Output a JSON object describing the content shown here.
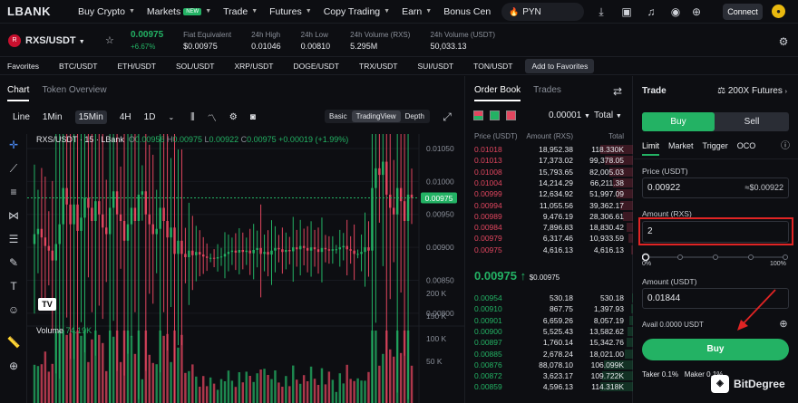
{
  "nav": {
    "logo": "LBANK",
    "items": [
      "Buy Crypto",
      "Markets",
      "Trade",
      "Futures",
      "Copy Trading",
      "Earn",
      "Bonus Cen"
    ],
    "markets_badge": "NEW",
    "search": "PYN",
    "connect": "Connect",
    "icons": [
      "download-icon",
      "wallet-icon",
      "bell-icon",
      "globe-icon",
      "gift-icon"
    ]
  },
  "ticker": {
    "pair": "RXS/USDT",
    "price": "0.00975",
    "change": "+6.67%",
    "fiat_label": "Fiat Equivalent",
    "fiat_value": "$0.00975",
    "high_label": "24h High",
    "high": "0.01046",
    "low_label": "24h Low",
    "low": "0.00810",
    "vol_rxs_label": "24h Volume (RXS)",
    "vol_rxs": "5.295M",
    "vol_usdt_label": "24h Volume (USDT)",
    "vol_usdt": "50,033.13"
  },
  "favorites": {
    "label": "Favorites",
    "items": [
      "BTC/USDT",
      "ETH/USDT",
      "SOL/USDT",
      "XRP/USDT",
      "DOGE/USDT",
      "TRX/USDT",
      "SUI/USDT",
      "TON/USDT"
    ],
    "add": "Add to Favorites"
  },
  "chart": {
    "tabs": [
      "Chart",
      "Token Overview"
    ],
    "timeframes": [
      "Line",
      "1Min",
      "15Min",
      "4H",
      "1D"
    ],
    "selected_tf": "15Min",
    "modes": [
      "Basic",
      "TradingView",
      "Depth"
    ],
    "selected_mode": "TradingView",
    "title": "RXS/USDT · 15 · LBank",
    "o": "0.00956",
    "h": "0.00975",
    "l": "0.00922",
    "c": "0.00975",
    "chg": "+0.00019 (+1.99%)",
    "volume_label": "Volume",
    "volume_value": "74.19K",
    "price_ticks": [
      "0.01050",
      "0.01000",
      "0.00950",
      "0.00900",
      "0.00850",
      "0.00800"
    ],
    "current_price_tag": "0.00975",
    "vol_ticks": [
      "200 K",
      "150 K",
      "100 K",
      "50 K"
    ],
    "tv_logo": "TV"
  },
  "orderbook": {
    "tabs": [
      "Order Book",
      "Trades"
    ],
    "tick": "0.00001",
    "total_sel": "Total",
    "headers": [
      "Price (USDT)",
      "Amount (RXS)",
      "Total"
    ],
    "asks": [
      [
        "0.01018",
        "18,952.38",
        "118.330K"
      ],
      [
        "0.01013",
        "17,373.02",
        "99,378.05"
      ],
      [
        "0.01008",
        "15,793.65",
        "82,005.03"
      ],
      [
        "0.01004",
        "14,214.29",
        "66,211.38"
      ],
      [
        "0.00999",
        "12,634.92",
        "51,997.09"
      ],
      [
        "0.00994",
        "11,055.56",
        "39,362.17"
      ],
      [
        "0.00989",
        "9,476.19",
        "28,306.61"
      ],
      [
        "0.00984",
        "7,896.83",
        "18,830.42"
      ],
      [
        "0.00979",
        "6,317.46",
        "10,933.59"
      ],
      [
        "0.00975",
        "4,616.13",
        "4,616.13"
      ]
    ],
    "mid_price": "0.00975 ↑",
    "mid_fiat": "$0.00975",
    "bids": [
      [
        "0.00954",
        "530.18",
        "530.18"
      ],
      [
        "0.00910",
        "867.75",
        "1,397.93"
      ],
      [
        "0.00901",
        "6,659.26",
        "8,057.19"
      ],
      [
        "0.00900",
        "5,525.43",
        "13,582.62"
      ],
      [
        "0.00897",
        "1,760.14",
        "15,342.76"
      ],
      [
        "0.00885",
        "2,678.24",
        "18,021.00"
      ],
      [
        "0.00876",
        "88,078.10",
        "106.099K"
      ],
      [
        "0.00872",
        "3,623.17",
        "109.722K"
      ],
      [
        "0.00859",
        "4,596.13",
        "114.318K"
      ]
    ]
  },
  "trade": {
    "title": "Trade",
    "futures": "200X Futures",
    "buy_tab": "Buy",
    "sell_tab": "Sell",
    "order_types": [
      "Limit",
      "Market",
      "Trigger",
      "OCO"
    ],
    "price_label": "Price (USDT)",
    "price_value": "0.00922",
    "price_equiv": "≈$0.00922",
    "amount_label": "Amount (RXS)",
    "amount_value": "2",
    "slider_min": "0%",
    "slider_max": "100%",
    "amount_usdt_label": "Amount (USDT)",
    "amount_usdt_value": "0.01844",
    "avail": "Avail 0.0000 USDT",
    "buy_button": "Buy",
    "taker": "Taker 0.1%",
    "maker": "Maker 0.1%"
  },
  "watermark": "BitDegree",
  "colors": {
    "up": "#23b264",
    "down": "#e2465f",
    "highlight": "#e02424"
  }
}
